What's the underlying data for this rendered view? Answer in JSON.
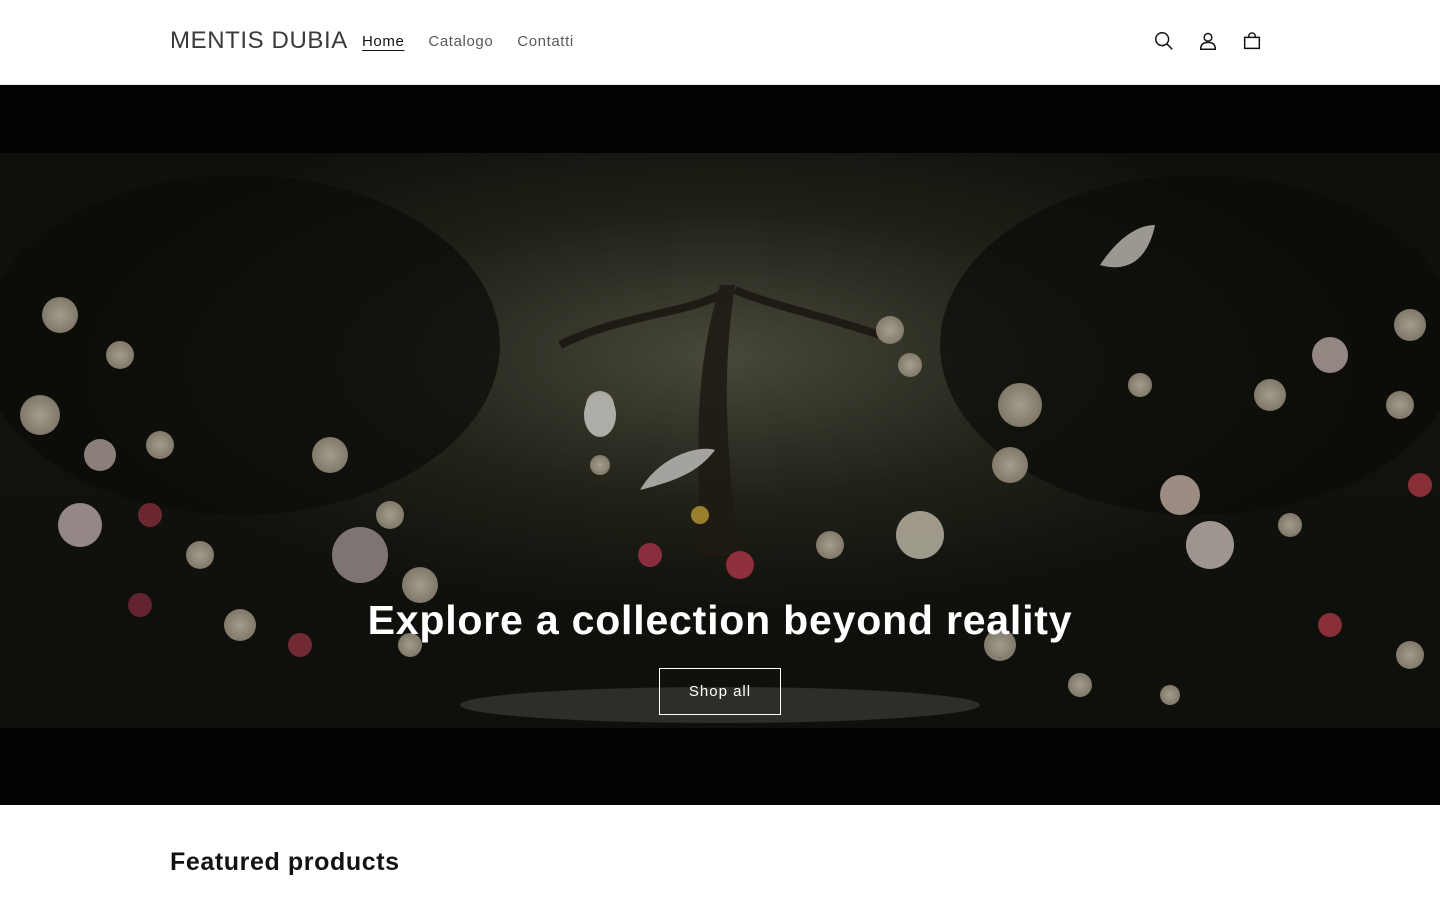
{
  "header": {
    "logo": "MENTIS DUBIA",
    "nav": [
      {
        "label": "Home",
        "active": true
      },
      {
        "label": "Catalogo",
        "active": false
      },
      {
        "label": "Contatti",
        "active": false
      }
    ],
    "icons": [
      "search-icon",
      "account-icon",
      "cart-icon"
    ]
  },
  "hero": {
    "title": "Explore a collection beyond reality",
    "button_label": "Shop all"
  },
  "featured": {
    "title": "Featured products"
  },
  "colors": {
    "text": "#121212",
    "header_bg": "#ffffff",
    "hero_dark": "#040404"
  }
}
